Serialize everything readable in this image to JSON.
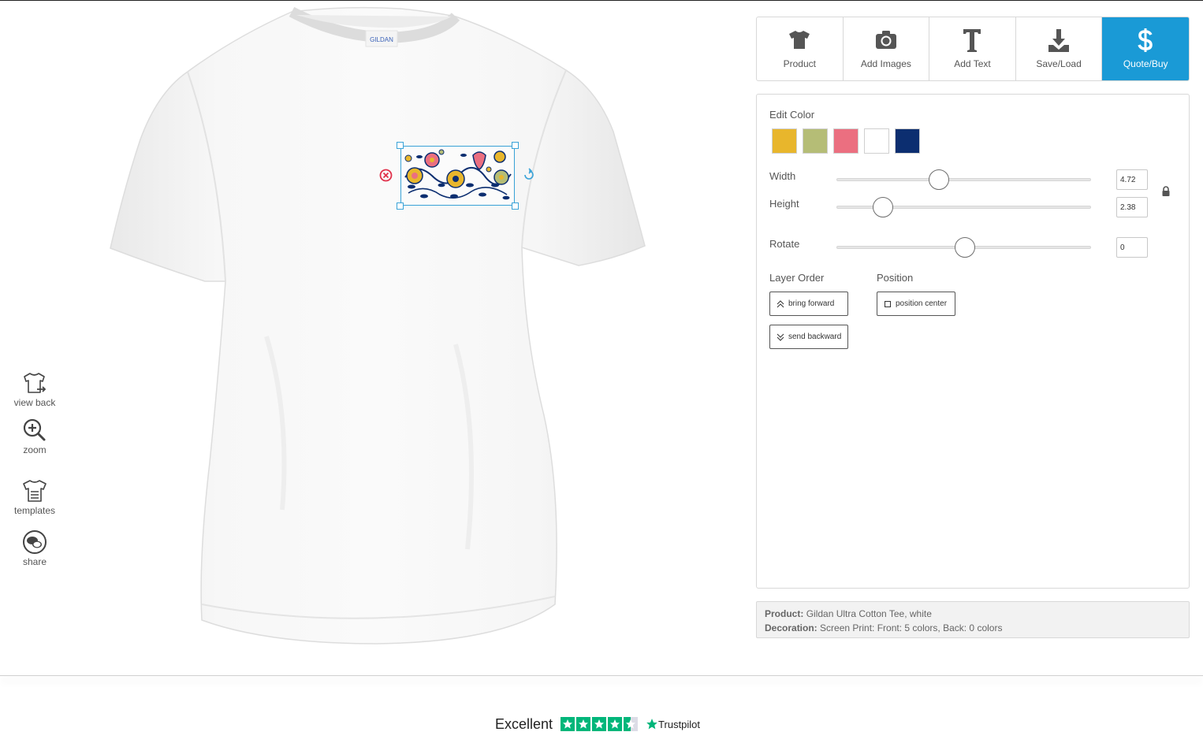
{
  "left_tools": [
    {
      "label": "view back",
      "icon": "shirt-flip-icon"
    },
    {
      "label": "zoom",
      "icon": "zoom-in-icon"
    },
    {
      "label": "templates",
      "icon": "template-shirt-icon"
    },
    {
      "label": "share",
      "icon": "share-chat-icon"
    }
  ],
  "toolbar": {
    "items": [
      {
        "label": "Product",
        "icon": "tshirt-icon"
      },
      {
        "label": "Add Images",
        "icon": "camera-icon"
      },
      {
        "label": "Add Text",
        "icon": "text-t-icon"
      },
      {
        "label": "Save/Load",
        "icon": "download-icon"
      },
      {
        "label": "Quote/Buy",
        "icon": "dollar-icon"
      }
    ],
    "active_color": "#1a9ad6"
  },
  "edit": {
    "color_title": "Edit Color",
    "colors": [
      "#e8b62c",
      "#b5bd76",
      "#eb6f80",
      "#ffffff",
      "#0c2e70"
    ],
    "width_label": "Width",
    "width_value": "4.72",
    "width_fraction": 0.4,
    "height_label": "Height",
    "height_value": "2.38",
    "height_fraction": 0.18,
    "rotate_label": "Rotate",
    "rotate_value": "0",
    "rotate_fraction": 0.5,
    "layer_title": "Layer Order",
    "bring_forward": "bring forward",
    "send_backward": "send backward",
    "position_title": "Position",
    "position_center": "position center"
  },
  "info": {
    "product_label": "Product:",
    "product_value": "Gildan Ultra Cotton Tee, white",
    "decoration_label": "Decoration:",
    "decoration_value": "Screen Print: Front: 5 colors, Back: 0 colors"
  },
  "shirt": {
    "tag_text": "GILDAN"
  },
  "trustpilot": {
    "rating_word": "Excellent",
    "brand": "Trustpilot",
    "stars": 4.5,
    "star_color": "#00b67a"
  }
}
